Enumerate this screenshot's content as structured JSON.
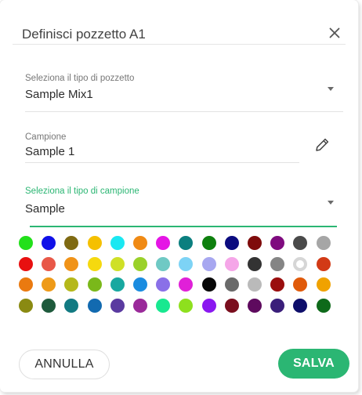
{
  "dialog": {
    "title": "Definisci pozzetto A1",
    "close_icon": "close-icon"
  },
  "well_type": {
    "label": "Seleziona il tipo di pozzetto",
    "value": "Sample Mix1"
  },
  "sample_name": {
    "label": "Campione",
    "value": "Sample 1",
    "edit_icon": "pencil-icon"
  },
  "sample_type": {
    "label": "Seleziona il tipo di campione",
    "value": "Sample",
    "active_color": "#2bb673"
  },
  "palette": {
    "rows": [
      [
        "#22e01a",
        "#1010e8",
        "#7f6a12",
        "#f5c000",
        "#1ae8f2",
        "#f08a14",
        "#e515e5",
        "#0b7f7f",
        "#0e800e",
        "#0b0b7f",
        "#7f0b0b",
        "#7f0b7f",
        "#4a4a4a",
        "#a6a6a6"
      ],
      [
        "#e81010",
        "#e85848",
        "#f09318",
        "#f5d90f",
        "#cfe027",
        "#9ad12a",
        "#6fc9c4",
        "#7dd3f5",
        "#a7a7f0",
        "#f5a6e8",
        "#333333",
        "#858585",
        "#ffffff",
        "#d23a16"
      ],
      [
        "#ea7a10",
        "#ee9a18",
        "#b5b81a",
        "#7ab81a",
        "#18a8a0",
        "#1a8ce0",
        "#8a70e8",
        "#e020d8",
        "#080808",
        "#6a6a6a",
        "#bababa",
        "#9a0e0e",
        "#e05a0a",
        "#f0a200"
      ],
      [
        "#8a8a12",
        "#1e5a3c",
        "#127a82",
        "#126ab0",
        "#5a3aa0",
        "#9a2a9a",
        "#18e890",
        "#8ee01e",
        "#8a18f0",
        "#7a0e1e",
        "#5e0a5e",
        "#3a1e7a",
        "#0e0e6a",
        "#0e6a1a"
      ]
    ]
  },
  "footer": {
    "cancel_label": "ANNULLA",
    "save_label": "SALVA"
  }
}
